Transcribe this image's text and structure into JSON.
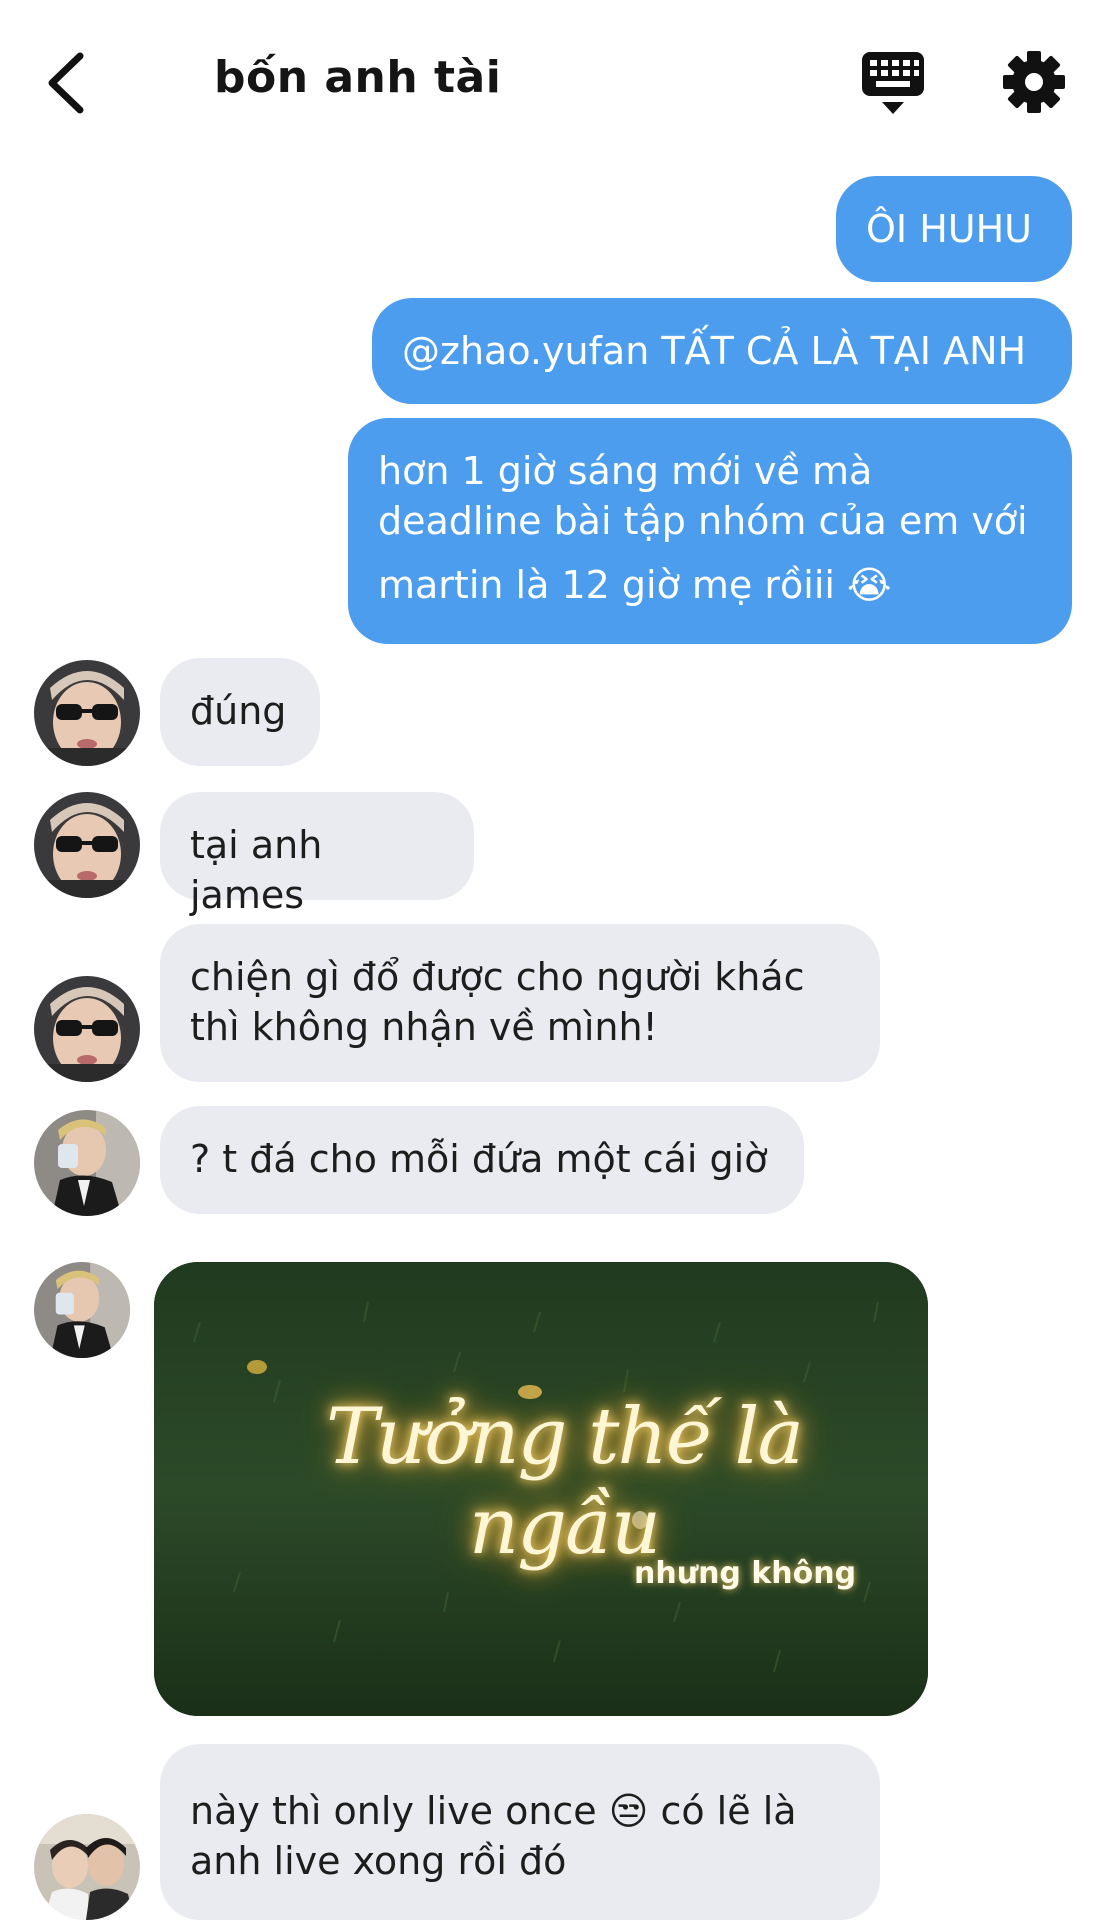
{
  "header": {
    "title": "bốn anh tài",
    "back_icon": "chevron-left-icon",
    "keyboard_icon": "keyboard-icon",
    "settings_icon": "gear-icon"
  },
  "colors": {
    "outgoing_bubble": "#4c9ded",
    "incoming_bubble": "#e9ebf0"
  },
  "messages_out": [
    {
      "text": "ÔI HUHU"
    },
    {
      "text": "@zhao.yufan TẤT CẢ LÀ TẠI ANH"
    },
    {
      "lines": [
        "hơn 1 giờ sáng mới về mà",
        "deadline bài tập nhóm của em với",
        "martin là 12 giờ mẹ rồiii 😭"
      ]
    }
  ],
  "messages_in": [
    {
      "sender_avatar": "avatar-sunglasses",
      "text": "đúng"
    },
    {
      "sender_avatar": "avatar-sunglasses",
      "text": "tại anh james"
    },
    {
      "sender_avatar": "avatar-sunglasses",
      "lines": [
        "chiện gì đổ được cho người khác",
        "thì không nhận về mình!"
      ]
    },
    {
      "sender_avatar": "avatar-mirror-selfie",
      "text": "? t đá cho mỗi đứa một cái giờ"
    },
    {
      "sender_avatar": "avatar-mirror-selfie",
      "image": {
        "title": "Tưởng thế là ngầu",
        "subtitle": "nhưng không"
      }
    },
    {
      "sender_avatar": "avatar-group",
      "lines": [
        "này thì only live once 😒 có lẽ là",
        "anh live xong rồi đó"
      ]
    }
  ]
}
